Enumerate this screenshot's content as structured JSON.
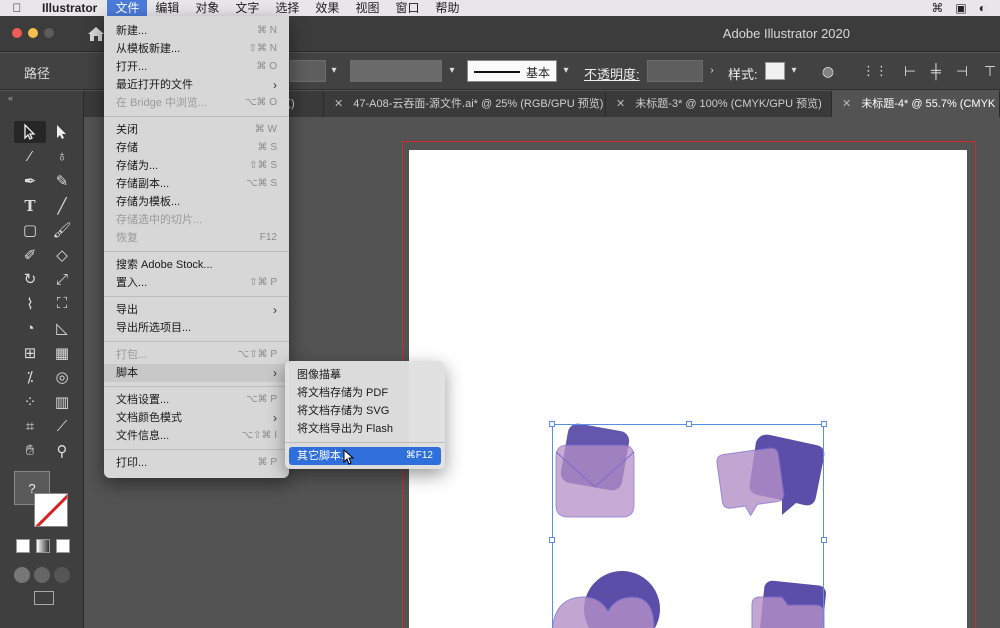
{
  "menubar": {
    "app": "Illustrator",
    "items": [
      "文件",
      "编辑",
      "对象",
      "文字",
      "选择",
      "效果",
      "视图",
      "窗口",
      "帮助"
    ],
    "active": "文件"
  },
  "window": {
    "title": "Adobe Illustrator 2020"
  },
  "control_bar": {
    "selection_type": "路径",
    "stroke_profile": "基本",
    "opacity_label": "不透明度:",
    "style_label": "样式:"
  },
  "tabs": [
    {
      "label": "览)",
      "active": false
    },
    {
      "label": "47-A08-云吞面-源文件.ai* @ 25% (RGB/GPU 预览)",
      "active": false
    },
    {
      "label": "未标题-3* @ 100% (CMYK/GPU 预览)",
      "active": false
    },
    {
      "label": "未标题-4* @ 55.7% (CMYK",
      "active": true
    }
  ],
  "file_menu": {
    "items": [
      {
        "label": "新建...",
        "shortcut": "⌘ N",
        "disabled": false
      },
      {
        "label": "从模板新建...",
        "shortcut": "⇧⌘ N",
        "disabled": false
      },
      {
        "label": "打开...",
        "shortcut": "⌘ O",
        "disabled": false
      },
      {
        "label": "最近打开的文件",
        "submenu": true,
        "disabled": false
      },
      {
        "label": "在 Bridge 中浏览...",
        "shortcut": "⌥⌘ O",
        "disabled": true
      },
      {
        "sep": true
      },
      {
        "label": "关闭",
        "shortcut": "⌘ W",
        "disabled": false
      },
      {
        "label": "存储",
        "shortcut": "⌘ S",
        "disabled": false
      },
      {
        "label": "存储为...",
        "shortcut": "⇧⌘ S",
        "disabled": false
      },
      {
        "label": "存储副本...",
        "shortcut": "⌥⌘ S",
        "disabled": false
      },
      {
        "label": "存储为模板...",
        "disabled": false
      },
      {
        "label": "存储选中的切片...",
        "disabled": true
      },
      {
        "label": "恢复",
        "shortcut": "F12",
        "disabled": true
      },
      {
        "sep": true
      },
      {
        "label": "搜索 Adobe Stock...",
        "disabled": false
      },
      {
        "label": "置入...",
        "shortcut": "⇧⌘ P",
        "disabled": false
      },
      {
        "sep": true
      },
      {
        "label": "导出",
        "submenu": true,
        "disabled": false
      },
      {
        "label": "导出所选项目...",
        "disabled": false
      },
      {
        "sep": true
      },
      {
        "label": "打包...",
        "shortcut": "⌥⇧⌘ P",
        "disabled": true
      },
      {
        "label": "脚本",
        "submenu": true,
        "disabled": false,
        "highlighted": true
      },
      {
        "sep": true
      },
      {
        "label": "文档设置...",
        "shortcut": "⌥⌘ P",
        "disabled": false
      },
      {
        "label": "文档颜色模式",
        "submenu": true,
        "disabled": false
      },
      {
        "label": "文件信息...",
        "shortcut": "⌥⇧⌘ I",
        "disabled": false
      },
      {
        "sep": true
      },
      {
        "label": "打印...",
        "shortcut": "⌘ P",
        "disabled": false
      }
    ]
  },
  "scripts_submenu": {
    "items": [
      {
        "label": "图像描摹"
      },
      {
        "label": "将文档存储为 PDF"
      },
      {
        "label": "将文档存储为 SVG"
      },
      {
        "label": "将文档导出为 Flash"
      },
      {
        "sep": true
      },
      {
        "label": "其它脚本...",
        "shortcut": "⌘F12",
        "highlighted": true
      }
    ]
  },
  "fill_stroke": {
    "fill_label": "?"
  },
  "colors": {
    "accent": "#2f6fdb",
    "shape_dark": "#5a4ea8",
    "shape_light": "#b58fc7",
    "artboard_border": "#d02a2a"
  }
}
